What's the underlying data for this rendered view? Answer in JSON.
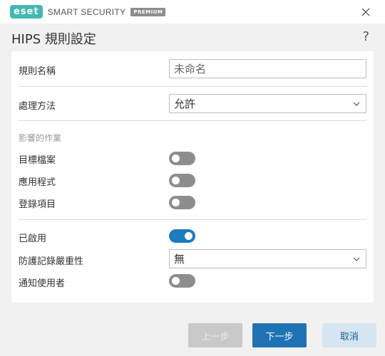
{
  "window": {
    "brand_logo": "eset",
    "product_name": "SMART SECURITY",
    "edition_badge": "PREMIUM"
  },
  "dialog": {
    "title": "HIPS 規則設定",
    "help_icon": "?"
  },
  "form": {
    "rule_name": {
      "label": "規則名稱",
      "value": "未命名"
    },
    "action": {
      "label": "處理方法",
      "value": "允許"
    },
    "affected_ops": {
      "section_label": "影響的作業",
      "items": [
        {
          "label": "目標檔案",
          "enabled": false
        },
        {
          "label": "應用程式",
          "enabled": false
        },
        {
          "label": "登錄項目",
          "enabled": false
        }
      ]
    },
    "enabled": {
      "label": "已啟用",
      "value": true
    },
    "log_severity": {
      "label": "防護記錄嚴重性",
      "value": "無"
    },
    "notify_user": {
      "label": "通知使用者",
      "value": false
    }
  },
  "buttons": {
    "back": "上一步",
    "next": "下一步",
    "cancel": "取消"
  },
  "colors": {
    "brand_teal": "#43b8b2",
    "toggle_on": "#1a7cbf",
    "toggle_off": "#8d8d8d",
    "primary_button": "#1f72b3",
    "disabled_button": "#c9c9c9",
    "secondary_button": "#d6e5f2"
  }
}
